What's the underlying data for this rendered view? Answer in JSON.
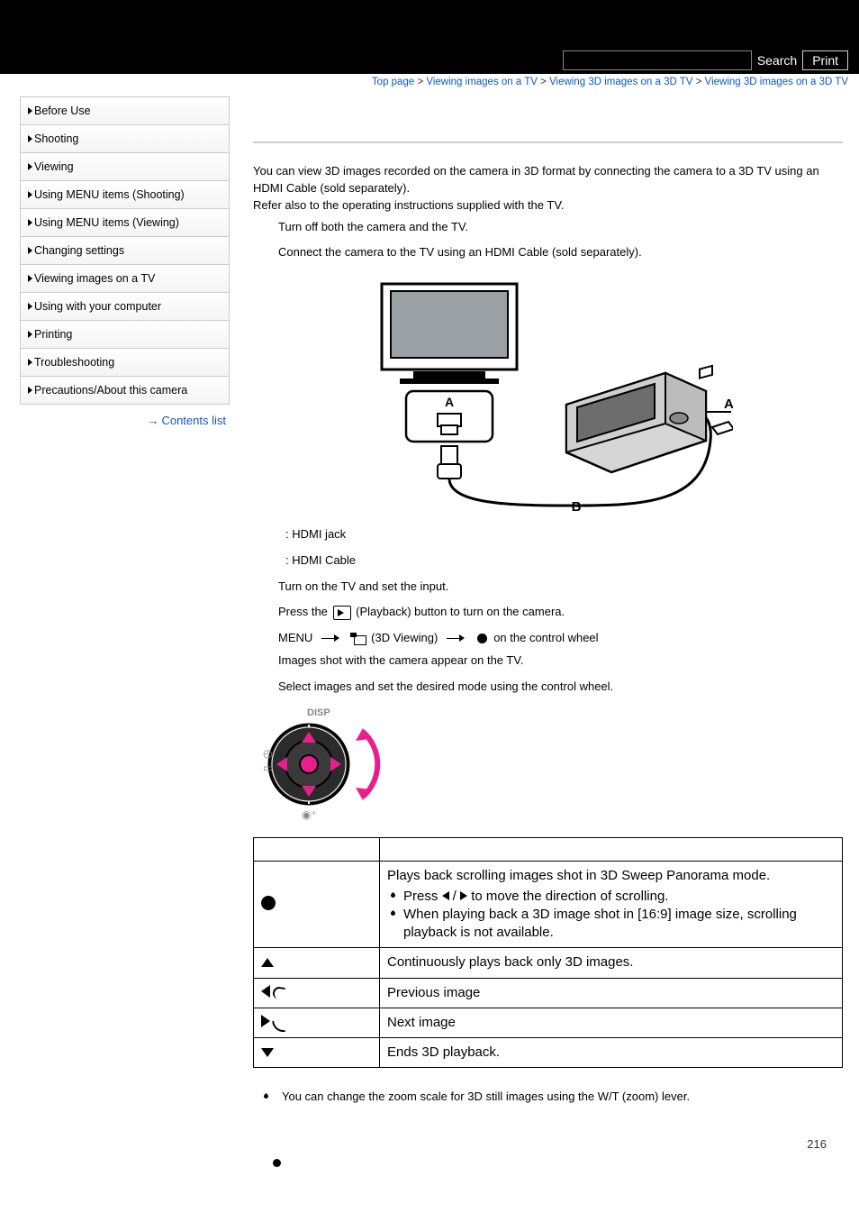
{
  "header": {
    "search_label": "Search",
    "print_label": "Print"
  },
  "breadcrumb": {
    "items": [
      "Top page",
      "Viewing images on a TV",
      "Viewing 3D images on a 3D TV",
      "Viewing 3D images on a 3D TV"
    ]
  },
  "sidebar": {
    "items": [
      {
        "label": "Before Use"
      },
      {
        "label": "Shooting"
      },
      {
        "label": "Viewing"
      },
      {
        "label": "Using MENU items (Shooting)"
      },
      {
        "label": "Using MENU items (Viewing)"
      },
      {
        "label": "Changing settings"
      },
      {
        "label": "Viewing images on a TV"
      },
      {
        "label": "Using with your computer"
      },
      {
        "label": "Printing"
      },
      {
        "label": "Troubleshooting"
      },
      {
        "label": "Precautions/About this camera"
      }
    ],
    "contents_list": "Contents list"
  },
  "main": {
    "intro_1": "You can view 3D images recorded on the camera in 3D format by connecting the camera to a 3D TV using an HDMI Cable (sold separately).",
    "intro_2": "Refer also to the operating instructions supplied with the TV.",
    "step_1": "Turn off both the camera and the TV.",
    "step_2": "Connect the camera to the TV using an HDMI Cable (sold separately).",
    "legend_a": " : HDMI jack",
    "legend_b": " : HDMI Cable",
    "step_3": "Turn on the TV and set the input.",
    "step_4a": "Press the ",
    "step_4b": "(Playback) button to turn on the camera.",
    "step_5_menu": "MENU ",
    "step_5_3d": "(3D Viewing) ",
    "step_5_end": " on the control wheel",
    "step_5_note": "Images shot with the camera appear on the TV.",
    "step_6": "Select images and set the desired mode using the control wheel.",
    "table": {
      "rows": [
        {
          "main": "Plays back scrolling images shot in 3D Sweep Panorama mode.",
          "sub1_a": "Press ",
          "sub1_b": " to move the direction of scrolling.",
          "sub2": "When playing back a 3D image shot in [16:9] image size, scrolling playback is not available."
        },
        {
          "main": "Continuously plays back only 3D images."
        },
        {
          "main": "Previous image"
        },
        {
          "main": "Next image"
        },
        {
          "main": "Ends 3D playback."
        }
      ]
    },
    "footnote": "You can change the zoom scale for 3D still images using the W/T (zoom) lever.",
    "page_number": "216"
  }
}
